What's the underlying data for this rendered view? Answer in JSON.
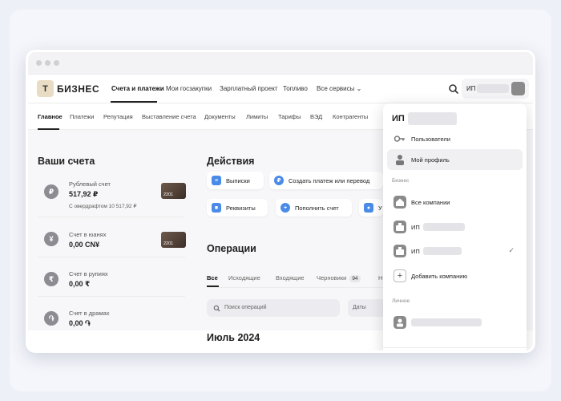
{
  "nav": {
    "logo_letter": "T",
    "brand": "БИЗНЕС",
    "items": [
      "Счета и платежи",
      "Мои госзакупки",
      "Зарплатный проект",
      "Топливо",
      "Все сервисы"
    ],
    "user_label": "ИП"
  },
  "subnav": [
    "Главное",
    "Платежи",
    "Репутация",
    "Выставление счета",
    "Документы",
    "Лимиты",
    "Тарифы",
    "ВЭД",
    "Контрагенты"
  ],
  "accounts": {
    "title": "Ваши счета",
    "items": [
      {
        "icon": "ruble-icon",
        "symbol": "₽",
        "name": "Рублевый счет",
        "amount": "517,92 ₽",
        "sub": "С овердрафтом 10 517,92 ₽",
        "card": "2201"
      },
      {
        "icon": "yuan-icon",
        "symbol": "¥",
        "name": "Счет в юанях",
        "amount": "0,00 CN¥",
        "card": "2201"
      },
      {
        "icon": "rupee-icon",
        "symbol": "₹",
        "name": "Счет в рупиях",
        "amount": "0,00 ₹"
      },
      {
        "icon": "dram-icon",
        "symbol": "֏",
        "name": "Счет в драмах",
        "amount": "0,00 ֏"
      }
    ]
  },
  "actions": {
    "title": "Действия",
    "buttons": [
      "Выписки",
      "Создать платеж или перевод",
      "Реквизиты",
      "Пополнить счет",
      "У"
    ]
  },
  "operations": {
    "title": "Операции",
    "tabs": [
      "Все",
      "Исходящие",
      "Входящие",
      "Черновики",
      "Н"
    ],
    "drafts_count": "94",
    "search_placeholder": "Поиск операций",
    "dates_label": "Даты",
    "month": "Июль 2024"
  },
  "dropdown": {
    "title": "ИП",
    "users": "Пользователи",
    "profile": "Мой профиль",
    "section_business": "Бизнес",
    "all_companies": "Все компании",
    "company1": "ИП",
    "company2": "ИП",
    "add_company": "Добавить компанию",
    "section_personal": "Личное"
  },
  "colors": {
    "accent": "#e9dcc4",
    "card": "#5a4638",
    "action_blue": "#4a8be8"
  }
}
